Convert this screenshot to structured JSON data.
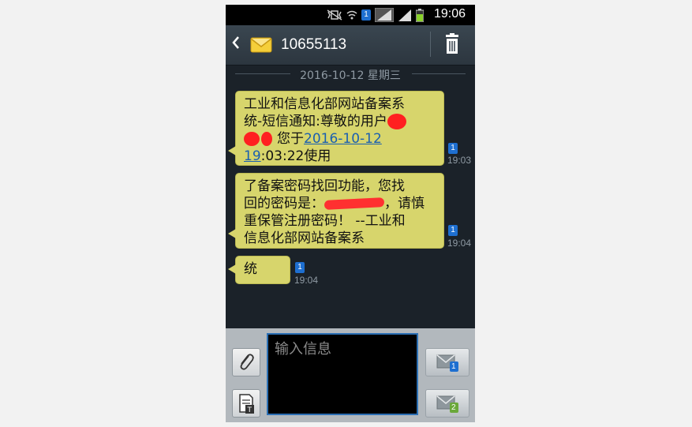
{
  "status_bar": {
    "time": "19:06",
    "sim_label": "1"
  },
  "header": {
    "contact": "10655113"
  },
  "conversation": {
    "date_label": "2016-10-12 星期三",
    "messages": [
      {
        "line1": "工业和信息化部网站备案系",
        "line2": "统-短信通知:尊敬的用户",
        "line3_suffix": "您于",
        "link": "2016-10-12",
        "line4_link": "19",
        "line4_suffix": ":03:22使用",
        "time": "19:03",
        "sim": "1"
      },
      {
        "line1": "了备案密码找回功能，您找",
        "line2_prefix": "回的密码是：",
        "line2_suffix": "，请慎",
        "line3": "重保管注册密码！ --工业和",
        "line4": "信息化部网站备案系",
        "time": "19:04",
        "sim": "1"
      },
      {
        "text": "统",
        "time": "19:04",
        "sim": "1"
      }
    ]
  },
  "composer": {
    "placeholder": "输入信息",
    "send_sim1": "1",
    "send_sim2": "2"
  },
  "colors": {
    "bubble": "#d7d56c",
    "screen_bg": "#1b2229",
    "header_bg": "#34404a",
    "link": "#1a5fb0"
  }
}
